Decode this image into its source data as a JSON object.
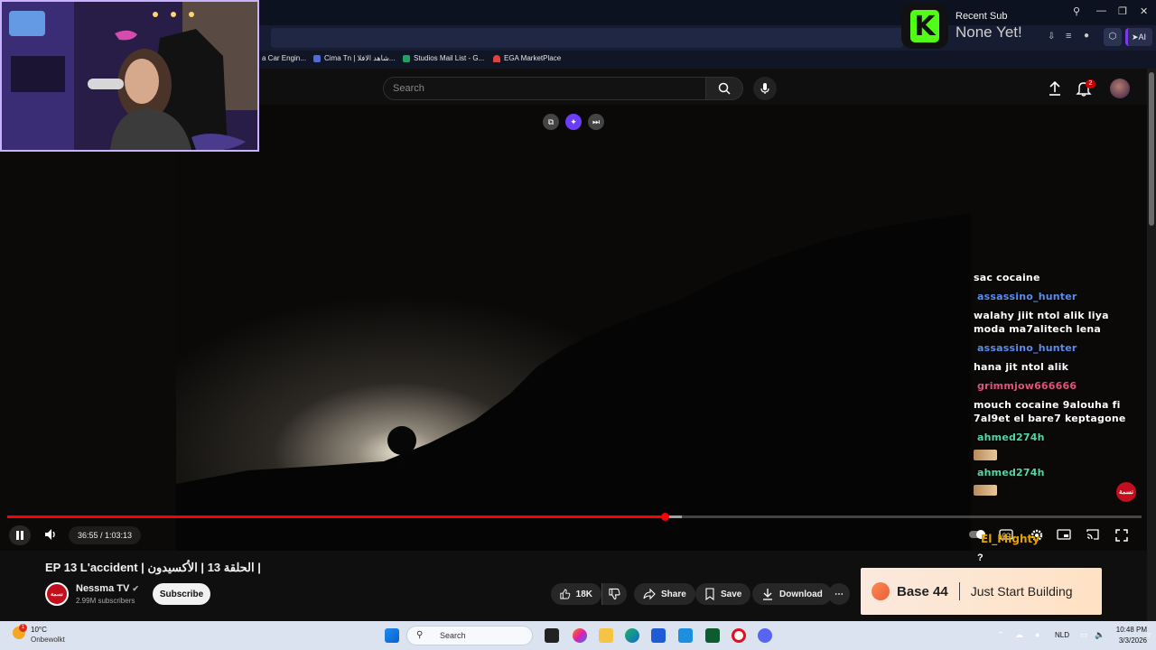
{
  "bookmarks": [
    {
      "label": "a Car Engin...",
      "color": "#888888"
    },
    {
      "label": "Cima Tn | شاهد الافلا...",
      "color": "#4f6bd6"
    },
    {
      "label": "Studios Mail List - G...",
      "color": "#1ea362"
    },
    {
      "label": "EGA MarketPlace",
      "color": "#e0433b"
    }
  ],
  "recent_sub": {
    "title": "Recent Sub",
    "name": "None Yet!"
  },
  "browser_ai_label": "AI",
  "youtube": {
    "search_placeholder": "Search",
    "notifications_count": "2"
  },
  "player": {
    "time": "36:55 / 1:03:13",
    "progress_fraction": 0.58,
    "buffered_fraction": 0.595
  },
  "chat": [
    {
      "type": "text",
      "text": "sac cocaine",
      "color": "#ffffff"
    },
    {
      "type": "user",
      "text": "assassino_hunter",
      "color": "#5b8def"
    },
    {
      "type": "text",
      "text": "walahy jiit ntol alik liya moda ma7alitech lena",
      "color": "#ffffff"
    },
    {
      "type": "user",
      "text": "assassino_hunter",
      "color": "#5b8def"
    },
    {
      "type": "text",
      "text": "hana jit ntol alik",
      "color": "#ffffff"
    },
    {
      "type": "user",
      "text": "grimmjow666666",
      "color": "#e0547c"
    },
    {
      "type": "text",
      "text": "mouch cocaine 9alouha fi 7al9et el bare7 keptagone",
      "color": "#ffffff"
    },
    {
      "type": "user",
      "text": "ahmed274h",
      "color": "#53d6a8"
    },
    {
      "type": "emote",
      "text": "",
      "color": ""
    },
    {
      "type": "user",
      "text": "ahmed274h",
      "color": "#53d6a8"
    },
    {
      "type": "emote",
      "text": "",
      "color": ""
    }
  ],
  "chat_last_user": "El_Mighty",
  "chat_last_msg": "?",
  "channel_overlay_logo": "نسمة",
  "video": {
    "title": "EP 13 L'accident | الحلقة 13 | الأكسيدون |",
    "channel": "Nessma TV",
    "subscribers": "2.99M subscribers",
    "subscribe_label": "Subscribe",
    "likes": "18K",
    "share_label": "Share",
    "save_label": "Save",
    "download_label": "Download"
  },
  "ad": {
    "brand": "Base 44",
    "tagline": "Just Start Building"
  },
  "taskbar": {
    "weather_temp": "10°C",
    "weather_desc": "Onbewolkt",
    "weather_alert": "1",
    "search_label": "Search",
    "language": "NLD",
    "time": "10:48 PM",
    "date": "3/3/2026"
  },
  "colors": {
    "accent_red": "#ff0000",
    "kick_green": "#53fc18",
    "ai_purple": "#7c3aed"
  }
}
